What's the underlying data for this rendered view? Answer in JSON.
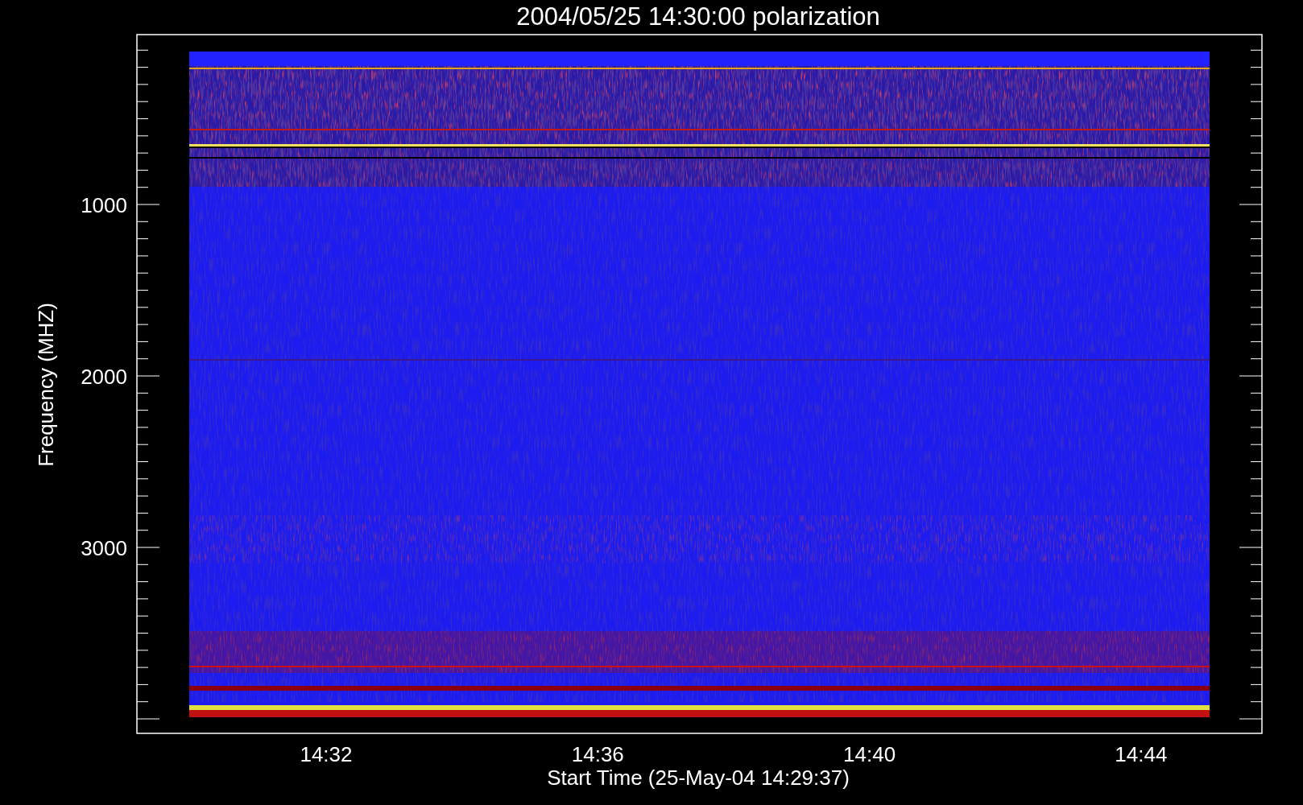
{
  "title": "2004/05/25 14:30:00 polarization",
  "plot": {
    "y_axis": {
      "title": "Frequency (MHZ)",
      "tick_labels": [
        "1000",
        "2000",
        "3000"
      ]
    },
    "x_axis": {
      "title": "Start Time (25-May-04 14:29:37)",
      "tick_labels": [
        "14:32",
        "14:36",
        "14:40",
        "14:44"
      ]
    }
  }
}
